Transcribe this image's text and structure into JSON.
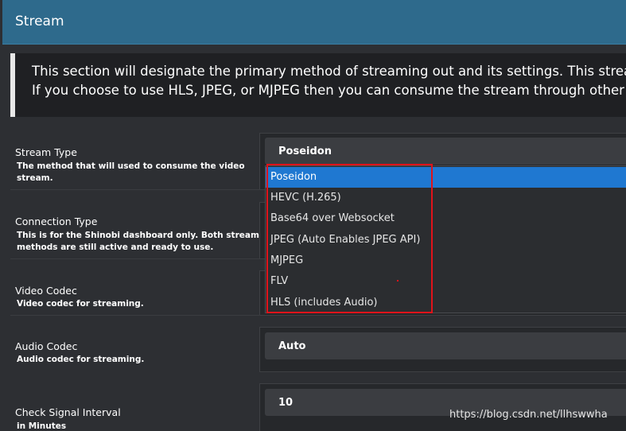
{
  "header": {
    "title": "Stream"
  },
  "info": {
    "line1": "This section will designate the primary method of streaming out and its settings. This stream will",
    "line2": "If you choose to use HLS, JPEG, or MJPEG then you can consume the stream through other prog"
  },
  "fields": {
    "stream_type": {
      "label": "Stream Type",
      "desc1": "The method that will used to consume the video",
      "desc2": "stream.",
      "value": "Poseidon"
    },
    "connection_type": {
      "label": "Connection Type",
      "desc1": "This is for the Shinobi dashboard only. Both stream",
      "desc2": "methods are still active and ready to use."
    },
    "video_codec": {
      "label": "Video Codec",
      "desc1": "Video codec for streaming."
    },
    "audio_codec": {
      "label": "Audio Codec",
      "desc1": "Audio codec for streaming.",
      "value": "Auto"
    },
    "check_signal": {
      "label": "Check Signal Interval",
      "desc1": "in Minutes",
      "value": "10"
    }
  },
  "dropdown": {
    "options": [
      "Poseidon",
      "HEVC (H.265)",
      "Base64 over Websocket",
      "JPEG (Auto Enables JPEG API)",
      "MJPEG",
      "FLV",
      "HLS (includes Audio)"
    ],
    "selected": "Poseidon"
  },
  "watermark": "https://blog.csdn.net/llhswwha",
  "colors": {
    "header_bg": "#2e6a8c",
    "selected_bg": "#1f78d1",
    "highlight_box": "#e0131a",
    "page_bg": "#2d2f33"
  }
}
